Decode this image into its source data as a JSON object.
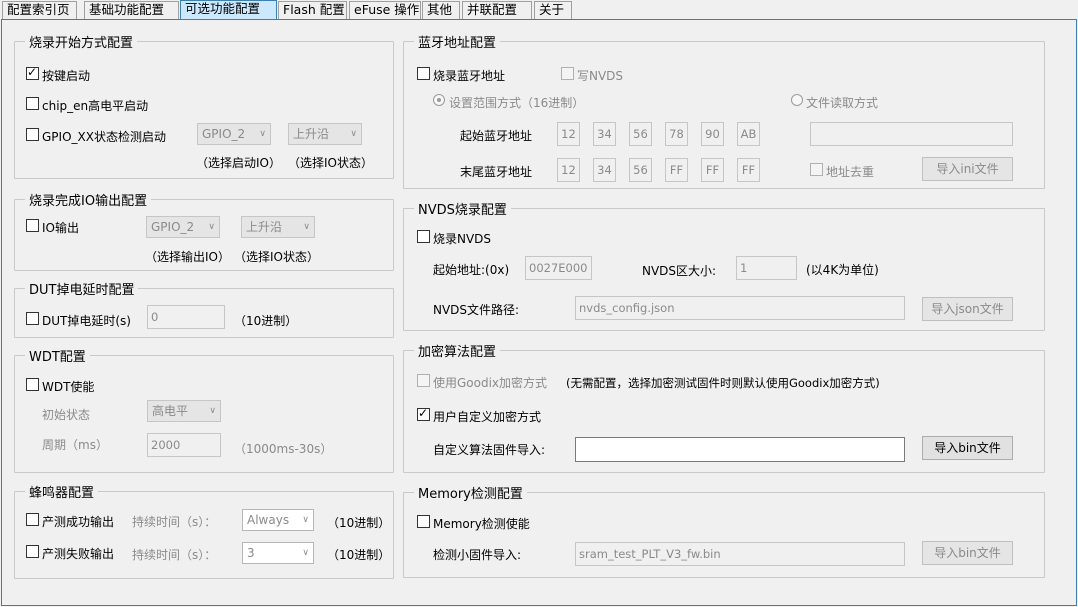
{
  "tabs": [
    {
      "label": "配置索引页"
    },
    {
      "label": "基础功能配置"
    },
    {
      "label": "可选功能配置"
    },
    {
      "label": "Flash 配置"
    },
    {
      "label": "eFuse 操作"
    },
    {
      "label": "其他"
    },
    {
      "label": "并联配置"
    },
    {
      "label": "关于"
    }
  ],
  "active_tab": "可选功能配置",
  "colors": {
    "accent": "#3c7fb1",
    "active_tab_bg": "#cce8ff"
  },
  "burn_start": {
    "title": "烧录开始方式配置",
    "key_start": "按键启动",
    "chip_en": "chip_en高电平启动",
    "gpio_detect": "GPIO_XX状态检测启动",
    "gpio_select": "GPIO_2",
    "state_select": "上升沿",
    "hint_io": "（选择启动IO）",
    "hint_state": "（选择IO状态）"
  },
  "io_output": {
    "title": "烧录完成IO输出配置",
    "io_out": "IO输出",
    "gpio_select": "GPIO_2",
    "state_select": "上升沿",
    "hint_io": "（选择输出IO）",
    "hint_state": "（选择IO状态）"
  },
  "dut": {
    "title": "DUT掉电延时配置",
    "label": "DUT掉电延时(s)",
    "value": "0",
    "hint": "（10进制）"
  },
  "wdt": {
    "title": "WDT配置",
    "enable": "WDT使能",
    "init_state_label": "初始状态",
    "init_state_value": "高电平",
    "period_label": "周期（ms）",
    "period_value": "2000",
    "period_hint": "（1000ms-30s）"
  },
  "buzzer": {
    "title": "蜂鸣器配置",
    "success": "产测成功输出",
    "fail": "产测失败输出",
    "duration_label": "持续时间（s）：",
    "success_value": "Always",
    "fail_value": "3",
    "hint": "（10进制）"
  },
  "bt": {
    "title": "蓝牙地址配置",
    "burn_addr": "烧录蓝牙地址",
    "write_nvds": "写NVDS",
    "range_mode": "设置范围方式（16进制）",
    "file_mode": "文件读取方式",
    "start_label": "起始蓝牙地址",
    "end_label": "末尾蓝牙地址",
    "start_bytes": [
      "12",
      "34",
      "56",
      "78",
      "90",
      "AB"
    ],
    "end_bytes": [
      "12",
      "34",
      "56",
      "FF",
      "FF",
      "FF"
    ],
    "file_path": "",
    "dedupe": "地址去重",
    "import_btn": "导入ini文件"
  },
  "nvds": {
    "title": "NVDS烧录配置",
    "burn": "烧录NVDS",
    "start_label": "起始地址:(0x)",
    "start_value": "0027E000",
    "size_label": "NVDS区大小:",
    "size_value": "1",
    "size_hint": "(以4K为单位)",
    "path_label": "NVDS文件路径:",
    "path_value": "nvds_config.json",
    "import_btn": "导入json文件"
  },
  "encrypt": {
    "title": "加密算法配置",
    "goodix": "使用Goodix加密方式",
    "goodix_hint": "(无需配置，选择加密测试固件时则默认使用Goodix加密方式)",
    "custom": "用户自定义加密方式",
    "fw_label": "自定义算法固件导入:",
    "fw_value": "",
    "import_btn": "导入bin文件"
  },
  "memory": {
    "title": "Memory检测配置",
    "enable": "Memory检测使能",
    "fw_label": "检测小固件导入:",
    "fw_value": "sram_test_PLT_V3_fw.bin",
    "import_btn": "导入bin文件"
  }
}
